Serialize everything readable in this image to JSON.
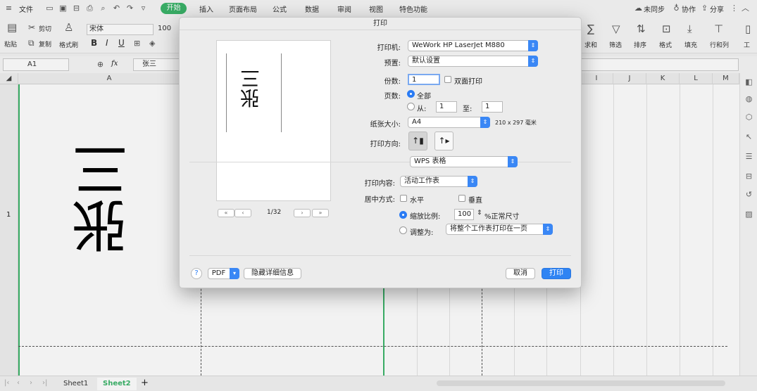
{
  "menubar": {
    "file_label": "文件",
    "start_tab": "开始",
    "tabs": [
      "插入",
      "页面布局",
      "公式",
      "数据",
      "审阅",
      "视图",
      "特色功能"
    ],
    "sync_label": "未同步",
    "collab_label": "协作",
    "share_label": "分享"
  },
  "ribbon": {
    "paste_label": "粘贴",
    "cut_label": "剪切",
    "copy_label": "复制",
    "format_painter_label": "格式刷",
    "font_name": "宋体",
    "font_size": "100",
    "bold": "B",
    "italic": "I",
    "underline": "U",
    "right_items": [
      "求和",
      "筛选",
      "排序",
      "格式",
      "填充",
      "行和列",
      "工"
    ]
  },
  "formula_bar": {
    "cell_ref": "A1",
    "fx_label": "fx",
    "content": "张三"
  },
  "grid": {
    "columns": [
      "A",
      "I",
      "J",
      "K",
      "L",
      "M"
    ],
    "rows": [
      "1"
    ],
    "cell_a1_text": "张三"
  },
  "sheets": {
    "tabs": [
      "Sheet1",
      "Sheet2"
    ],
    "active": "Sheet2",
    "add_label": "+"
  },
  "dialog": {
    "title": "打印",
    "printer_label": "打印机:",
    "printer_value": "WeWork HP LaserJet M880",
    "preset_label": "预置:",
    "preset_value": "默认设置",
    "copies_label": "份数:",
    "copies_value": "1",
    "duplex_label": "双面打印",
    "pages_label": "页数:",
    "pages_all": "全部",
    "pages_from": "从:",
    "pages_from_value": "1",
    "pages_to": "至:",
    "pages_to_value": "1",
    "paper_label": "纸张大小:",
    "paper_value": "A4",
    "paper_dims": "210 x 297 毫米",
    "orientation_label": "打印方向:",
    "app_select": "WPS 表格",
    "content_label": "打印内容:",
    "content_value": "活动工作表",
    "center_label": "居中方式:",
    "center_horizontal": "水平",
    "center_vertical": "垂直",
    "scale_label": "缩放比例:",
    "scale_value": "100",
    "scale_suffix": "%正常尺寸",
    "fit_label": "调整为:",
    "fit_value": "将整个工作表打印在一页",
    "page_indicator": "1/32",
    "preview_text": "张三",
    "help_label": "?",
    "pdf_label": "PDF",
    "hide_details_label": "隐藏详细信息",
    "cancel_label": "取消",
    "print_label": "打印"
  },
  "colors": {
    "accent_green": "#3cb56a",
    "accent_blue": "#2f84f3"
  }
}
